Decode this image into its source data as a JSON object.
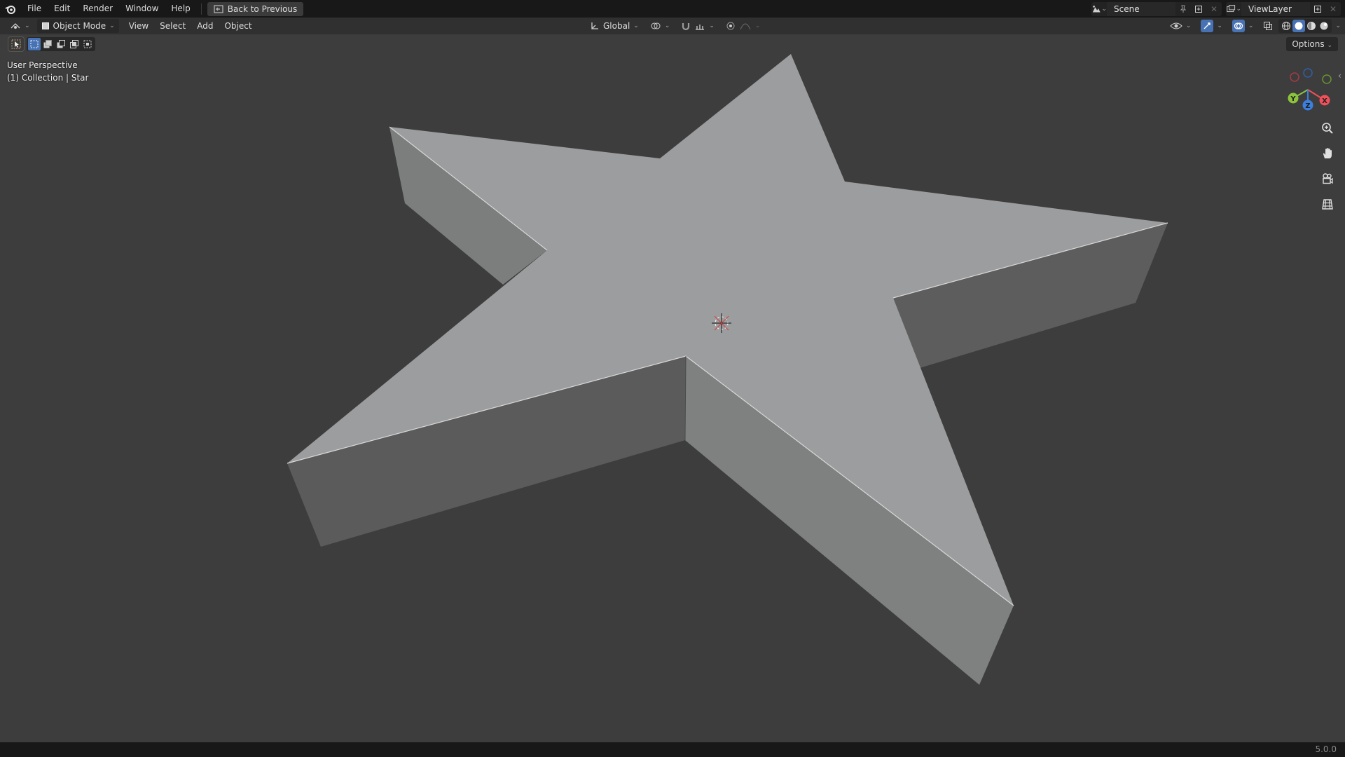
{
  "topbar": {
    "menu": [
      "File",
      "Edit",
      "Render",
      "Window",
      "Help"
    ],
    "back_button": "Back to Previous",
    "scene_label": "Scene",
    "viewlayer_label": "ViewLayer"
  },
  "viewport_header": {
    "mode": "Object Mode",
    "menus": [
      "View",
      "Select",
      "Add",
      "Object"
    ],
    "transform_orientation": "Global",
    "options": "Options"
  },
  "overlay": {
    "view_name": "User Perspective",
    "collection_info": "(1) Collection | Star"
  },
  "gizmo": {
    "axis_labels": [
      "X",
      "Y",
      "Z"
    ],
    "colors": {
      "x": "#f0505a",
      "y": "#8bc43c",
      "z": "#3b7fe0"
    }
  },
  "nav_icons": [
    "zoom-icon",
    "pan-hand-icon",
    "camera-view-icon",
    "ortho-grid-icon"
  ],
  "status": {
    "version": "5.0.0"
  },
  "colors": {
    "viewport_bg": "#3d3d3d",
    "star_top": "#9c9d9e",
    "star_side_dark": "#5b5b5b",
    "star_side_light": "#808181",
    "accent": "#4772b3"
  }
}
